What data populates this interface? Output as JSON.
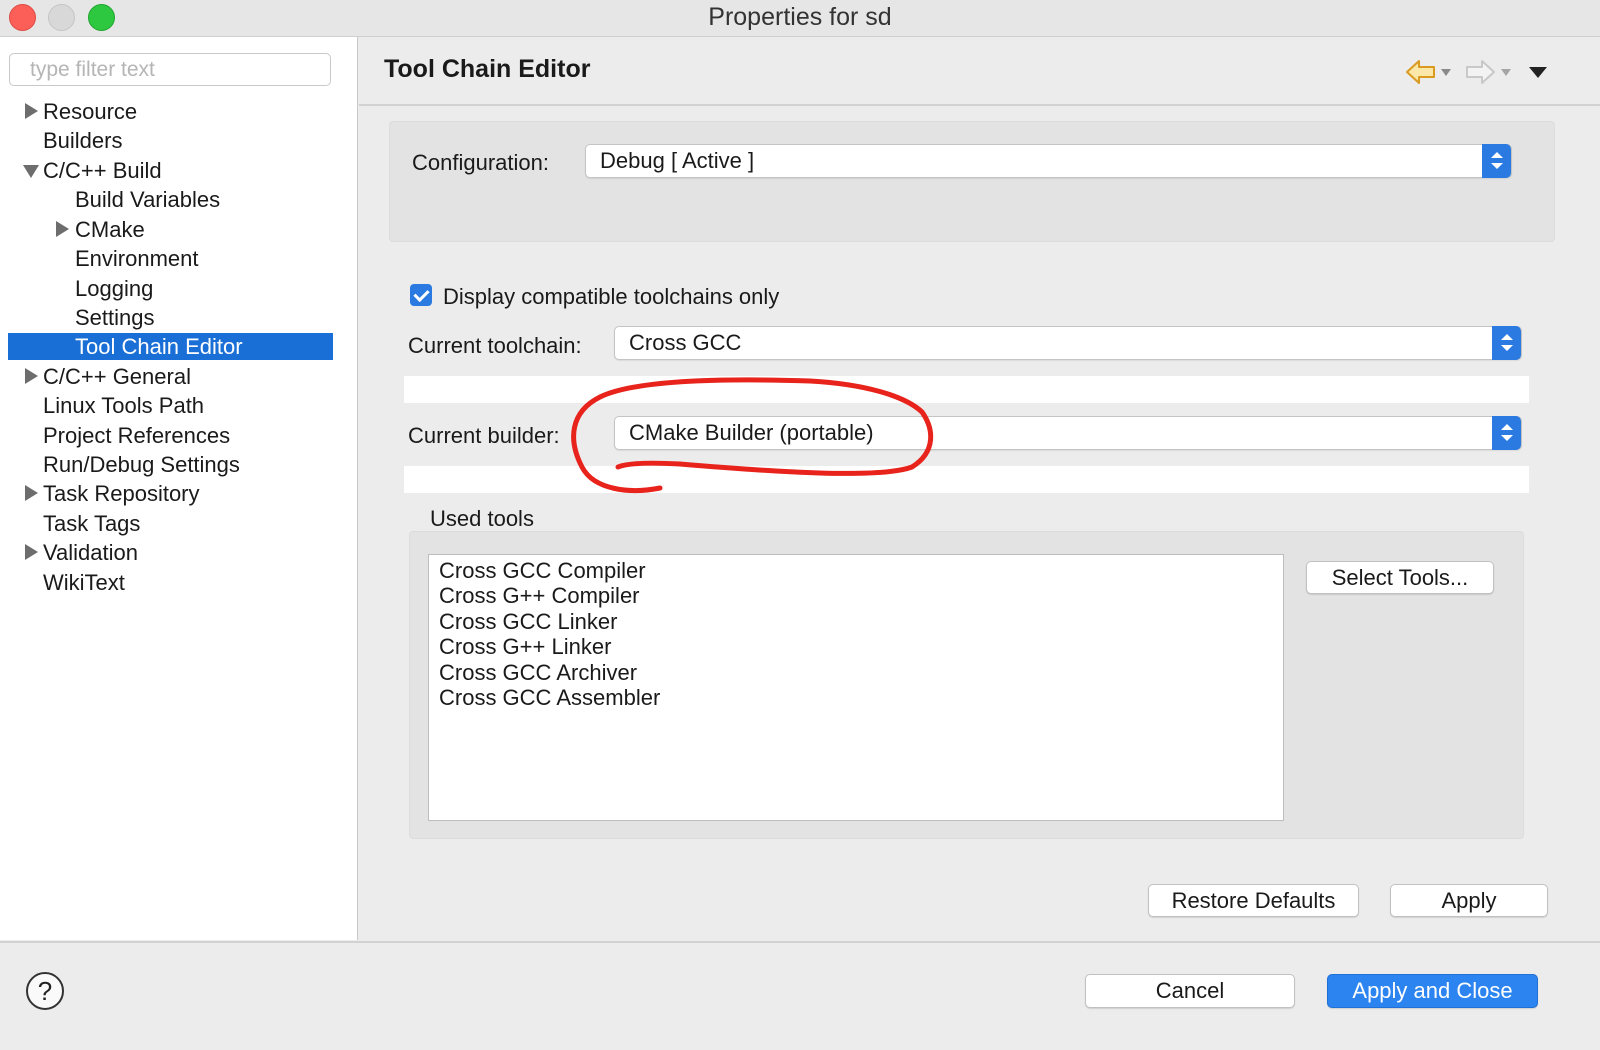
{
  "window": {
    "title": "Properties for sd"
  },
  "sidebar": {
    "filter_placeholder": "type filter text",
    "items": [
      {
        "label": "Resource",
        "expander": "collapsed"
      },
      {
        "label": "Builders",
        "expander": "none"
      },
      {
        "label": "C/C++ Build",
        "expander": "expanded"
      },
      {
        "label": "Build Variables",
        "expander": "none"
      },
      {
        "label": "CMake",
        "expander": "collapsed"
      },
      {
        "label": "Environment",
        "expander": "none"
      },
      {
        "label": "Logging",
        "expander": "none"
      },
      {
        "label": "Settings",
        "expander": "none"
      },
      {
        "label": "Tool Chain Editor",
        "expander": "none",
        "selected": true
      },
      {
        "label": "C/C++ General",
        "expander": "collapsed"
      },
      {
        "label": "Linux Tools Path",
        "expander": "none"
      },
      {
        "label": "Project References",
        "expander": "none"
      },
      {
        "label": "Run/Debug Settings",
        "expander": "none"
      },
      {
        "label": "Task Repository",
        "expander": "collapsed"
      },
      {
        "label": "Task Tags",
        "expander": "none"
      },
      {
        "label": "Validation",
        "expander": "collapsed"
      },
      {
        "label": "WikiText",
        "expander": "none"
      }
    ]
  },
  "main": {
    "page_title": "Tool Chain Editor",
    "nav": {
      "back_icon": "back-arrow-icon",
      "forward_icon": "forward-arrow-icon",
      "menu_icon": "view-menu-icon"
    },
    "configuration": {
      "label": "Configuration:",
      "value": "Debug  [ Active ]"
    },
    "display_compatible": {
      "label": "Display compatible toolchains only",
      "checked": true
    },
    "toolchain": {
      "label": "Current toolchain:",
      "value": "Cross GCC"
    },
    "builder": {
      "label": "Current builder:",
      "value": "CMake Builder (portable)"
    },
    "used_tools": {
      "label": "Used tools",
      "items": [
        "Cross GCC Compiler",
        "Cross G++ Compiler",
        "Cross GCC Linker",
        "Cross G++ Linker",
        "Cross GCC Archiver",
        "Cross GCC Assembler"
      ],
      "select_button": "Select Tools..."
    },
    "restore_defaults": "Restore Defaults",
    "apply": "Apply"
  },
  "footer": {
    "help_icon": "help-icon",
    "help_glyph": "?",
    "cancel": "Cancel",
    "apply_and_close": "Apply and Close"
  },
  "colors": {
    "accent": "#2a7ae2",
    "selection": "#1a6fd6",
    "annotation": "#e8231c",
    "back_arrow": "#d99a1f"
  }
}
